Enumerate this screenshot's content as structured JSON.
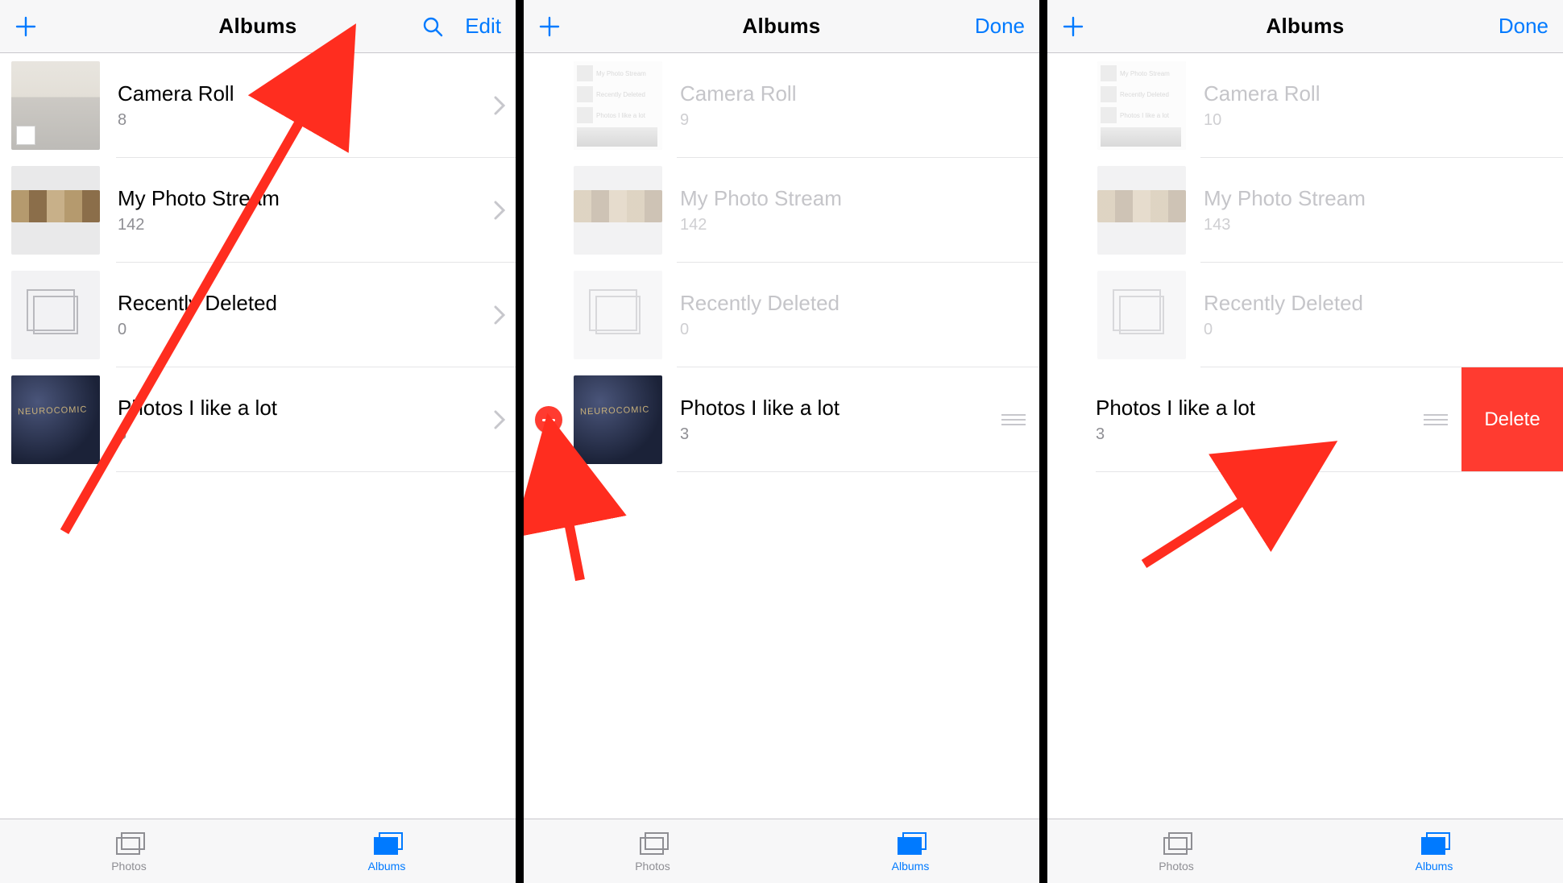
{
  "colors": {
    "accent": "#007aff",
    "destructive": "#ff3b30"
  },
  "screens": [
    {
      "nav": {
        "title": "Albums",
        "left": "plus",
        "right_items": [
          "search",
          "edit"
        ],
        "edit_label": "Edit"
      },
      "albums": [
        {
          "title": "Camera Roll",
          "count": 8,
          "thumb": "camera-roll",
          "editable": false
        },
        {
          "title": "My Photo Stream",
          "count": 142,
          "thumb": "stream",
          "editable": false
        },
        {
          "title": "Recently Deleted",
          "count": 0,
          "thumb": "stack",
          "editable": false
        },
        {
          "title": "Photos I like a lot",
          "count": 3,
          "thumb": "photos-like",
          "editable": true
        }
      ],
      "tabs": {
        "photos": "Photos",
        "albums": "Albums",
        "active": "albums"
      }
    },
    {
      "nav": {
        "title": "Albums",
        "left": "plus",
        "right_items": [
          "done"
        ],
        "done_label": "Done"
      },
      "albums": [
        {
          "title": "Camera Roll",
          "count": 9,
          "thumb": "mini-list",
          "editable": false,
          "dimmed": true
        },
        {
          "title": "My Photo Stream",
          "count": 142,
          "thumb": "stream",
          "editable": false,
          "dimmed": true
        },
        {
          "title": "Recently Deleted",
          "count": 0,
          "thumb": "stack",
          "editable": false,
          "dimmed": true
        },
        {
          "title": "Photos I like a lot",
          "count": 3,
          "thumb": "photos-like",
          "editable": true,
          "show_minus": true,
          "show_reorder": true
        }
      ],
      "tabs": {
        "photos": "Photos",
        "albums": "Albums",
        "active": "albums"
      }
    },
    {
      "nav": {
        "title": "Albums",
        "left": "plus",
        "right_items": [
          "done"
        ],
        "done_label": "Done"
      },
      "albums": [
        {
          "title": "Camera Roll",
          "count": 10,
          "thumb": "mini-list",
          "editable": false,
          "dimmed": true
        },
        {
          "title": "My Photo Stream",
          "count": 143,
          "thumb": "stream",
          "editable": false,
          "dimmed": true
        },
        {
          "title": "Recently Deleted",
          "count": 0,
          "thumb": "stack",
          "editable": false,
          "dimmed": true
        },
        {
          "title": "Photos I like a lot",
          "count": 3,
          "thumb": "photos-like",
          "editable": true,
          "show_reorder": true,
          "show_delete": true,
          "hide_thumb": true
        }
      ],
      "delete_label": "Delete",
      "tabs": {
        "photos": "Photos",
        "albums": "Albums",
        "active": "albums"
      }
    }
  ],
  "mini_rows": [
    "My Photo Stream",
    "Recently Deleted",
    "Photos I like a lot"
  ]
}
